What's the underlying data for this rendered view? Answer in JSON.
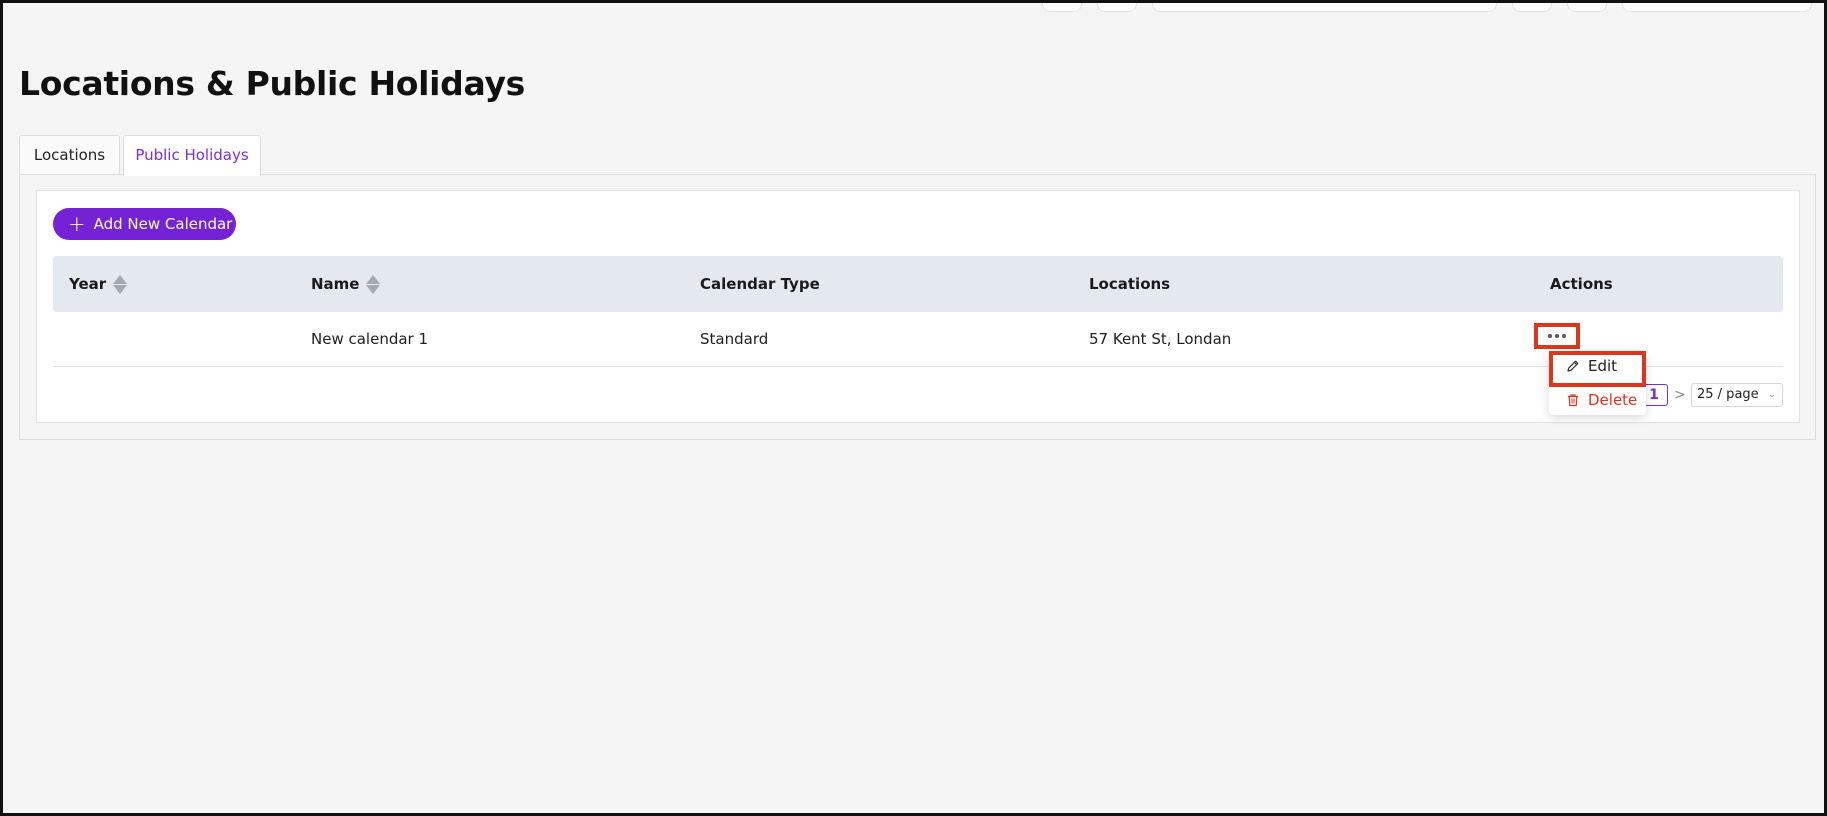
{
  "page": {
    "title": "Locations & Public Holidays"
  },
  "tabs": [
    {
      "label": "Locations",
      "active": false
    },
    {
      "label": "Public Holidays",
      "active": true
    }
  ],
  "toolbar": {
    "add_label": "Add New Calendar"
  },
  "table": {
    "columns": [
      {
        "label": "Year",
        "sortable": true
      },
      {
        "label": "Name",
        "sortable": true
      },
      {
        "label": "Calendar Type",
        "sortable": false
      },
      {
        "label": "Locations",
        "sortable": false
      },
      {
        "label": "Actions",
        "sortable": false
      }
    ],
    "rows": [
      {
        "year": "",
        "name": "New calendar 1",
        "calendar_type": "Standard",
        "locations": "57 Kent St, Londan"
      }
    ]
  },
  "actions_menu": {
    "edit_label": "Edit",
    "delete_label": "Delete"
  },
  "pagination": {
    "current_page": "1",
    "next_symbol": ">",
    "page_size": "25 / page"
  },
  "colors": {
    "accent": "#7522d6",
    "danger": "#e0301e",
    "highlight": "#d9381e",
    "table_header_bg": "#e4e8ef"
  }
}
